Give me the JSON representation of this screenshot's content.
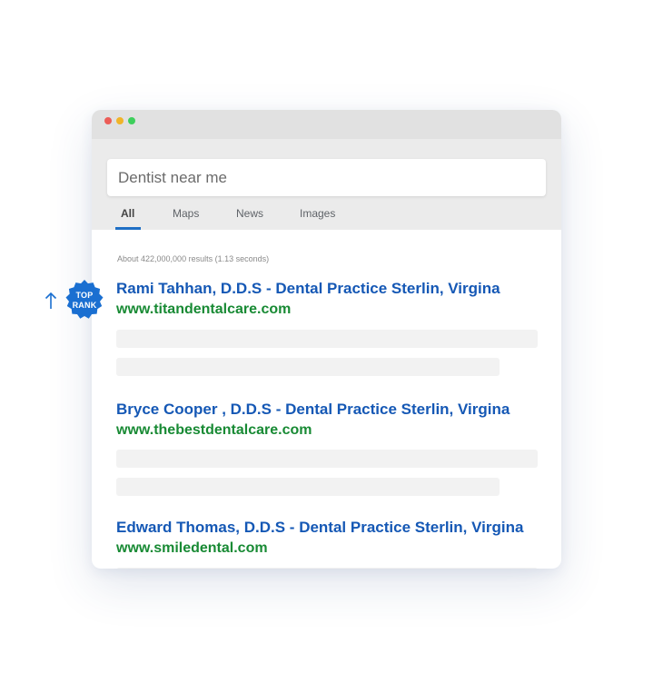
{
  "search": {
    "query": "Dentist near me"
  },
  "tabs": [
    {
      "label": "All",
      "active": true
    },
    {
      "label": "Maps",
      "active": false
    },
    {
      "label": "News",
      "active": false
    },
    {
      "label": "Images",
      "active": false
    }
  ],
  "results_stats": "About 422,000,000 results (1.13 seconds)",
  "badge": {
    "line1": "TOP",
    "line2": "RANK",
    "color": "#1a6fd1"
  },
  "results": [
    {
      "title": "Rami Tahhan, D.D.S - Dental Practice Sterlin, Virgina",
      "url": "www.titandentalcare.com"
    },
    {
      "title": "Bryce Cooper , D.D.S - Dental Practice Sterlin, Virgina",
      "url": "www.thebestdentalcare.com"
    },
    {
      "title": "Edward Thomas, D.D.S - Dental Practice Sterlin, Virgina",
      "url": "www.smiledental.com"
    }
  ],
  "colors": {
    "title_link": "#1558b5",
    "url_text": "#188a34",
    "tab_active_underline": "#1f6fc5"
  }
}
